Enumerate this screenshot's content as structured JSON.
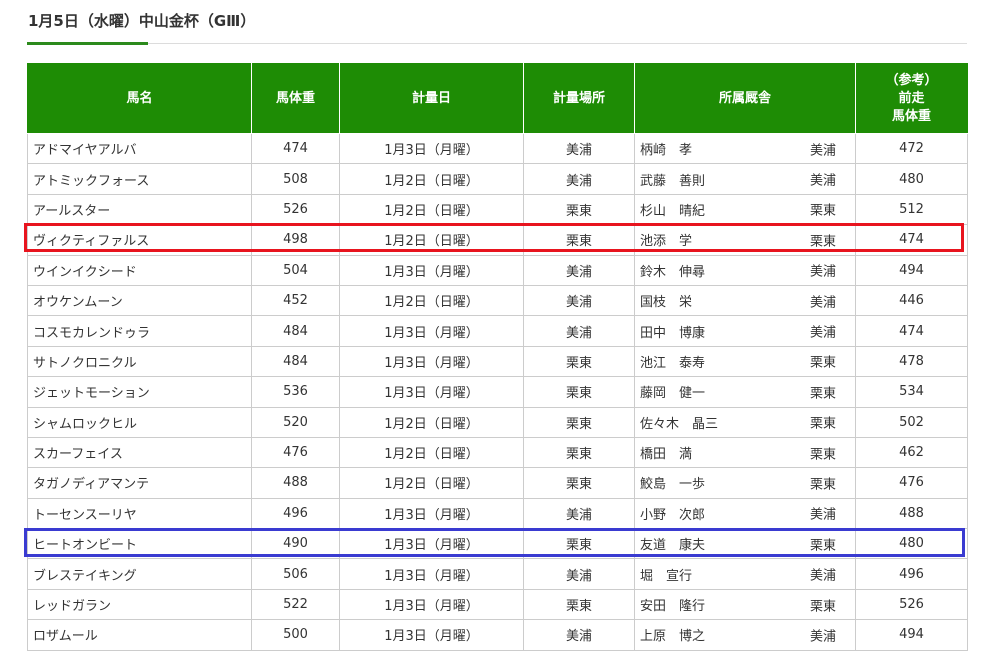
{
  "title": "1月5日（水曜）中山金杯（GⅢ）",
  "headers": {
    "name": "馬名",
    "weight": "馬体重",
    "date": "計量日",
    "place": "計量場所",
    "stable": "所属厩舎",
    "prev_line1": "（参考）",
    "prev_line2": "前走",
    "prev_line3": "馬体重"
  },
  "rows": [
    {
      "name": "アドマイヤアルバ",
      "weight": "474",
      "date": "1月3日（月曜）",
      "place": "美浦",
      "trainer": "柄崎　孝",
      "loc": "美浦",
      "prev": "472"
    },
    {
      "name": "アトミックフォース",
      "weight": "508",
      "date": "1月2日（日曜）",
      "place": "美浦",
      "trainer": "武藤　善則",
      "loc": "美浦",
      "prev": "480"
    },
    {
      "name": "アールスター",
      "weight": "526",
      "date": "1月2日（日曜）",
      "place": "栗東",
      "trainer": "杉山　晴紀",
      "loc": "栗東",
      "prev": "512"
    },
    {
      "name": "ヴィクティファルス",
      "weight": "498",
      "date": "1月2日（日曜）",
      "place": "栗東",
      "trainer": "池添　学",
      "loc": "栗東",
      "prev": "474"
    },
    {
      "name": "ウインイクシード",
      "weight": "504",
      "date": "1月3日（月曜）",
      "place": "美浦",
      "trainer": "鈴木　伸尋",
      "loc": "美浦",
      "prev": "494"
    },
    {
      "name": "オウケンムーン",
      "weight": "452",
      "date": "1月2日（日曜）",
      "place": "美浦",
      "trainer": "国枝　栄",
      "loc": "美浦",
      "prev": "446"
    },
    {
      "name": "コスモカレンドゥラ",
      "weight": "484",
      "date": "1月3日（月曜）",
      "place": "美浦",
      "trainer": "田中　博康",
      "loc": "美浦",
      "prev": "474"
    },
    {
      "name": "サトノクロニクル",
      "weight": "484",
      "date": "1月3日（月曜）",
      "place": "栗東",
      "trainer": "池江　泰寿",
      "loc": "栗東",
      "prev": "478"
    },
    {
      "name": "ジェットモーション",
      "weight": "536",
      "date": "1月3日（月曜）",
      "place": "栗東",
      "trainer": "藤岡　健一",
      "loc": "栗東",
      "prev": "534"
    },
    {
      "name": "シャムロックヒル",
      "weight": "520",
      "date": "1月2日（日曜）",
      "place": "栗東",
      "trainer": "佐々木　晶三",
      "loc": "栗東",
      "prev": "502"
    },
    {
      "name": "スカーフェイス",
      "weight": "476",
      "date": "1月2日（日曜）",
      "place": "栗東",
      "trainer": "橋田　満",
      "loc": "栗東",
      "prev": "462"
    },
    {
      "name": "タガノディアマンテ",
      "weight": "488",
      "date": "1月2日（日曜）",
      "place": "栗東",
      "trainer": "鮫島　一歩",
      "loc": "栗東",
      "prev": "476"
    },
    {
      "name": "トーセンスーリヤ",
      "weight": "496",
      "date": "1月3日（月曜）",
      "place": "美浦",
      "trainer": "小野　次郎",
      "loc": "美浦",
      "prev": "488"
    },
    {
      "name": "ヒートオンビート",
      "weight": "490",
      "date": "1月3日（月曜）",
      "place": "栗東",
      "trainer": "友道　康夫",
      "loc": "栗東",
      "prev": "480"
    },
    {
      "name": "ブレステイキング",
      "weight": "506",
      "date": "1月3日（月曜）",
      "place": "美浦",
      "trainer": "堀　宣行",
      "loc": "美浦",
      "prev": "496"
    },
    {
      "name": "レッドガラン",
      "weight": "522",
      "date": "1月3日（月曜）",
      "place": "栗東",
      "trainer": "安田　隆行",
      "loc": "栗東",
      "prev": "526"
    },
    {
      "name": "ロザムール",
      "weight": "500",
      "date": "1月3日（月曜）",
      "place": "美浦",
      "trainer": "上原　博之",
      "loc": "美浦",
      "prev": "494"
    }
  ],
  "colors": {
    "header_bg": "#1e8c05",
    "highlight_red": "#e8141e",
    "highlight_blue": "#3a3bd1"
  }
}
